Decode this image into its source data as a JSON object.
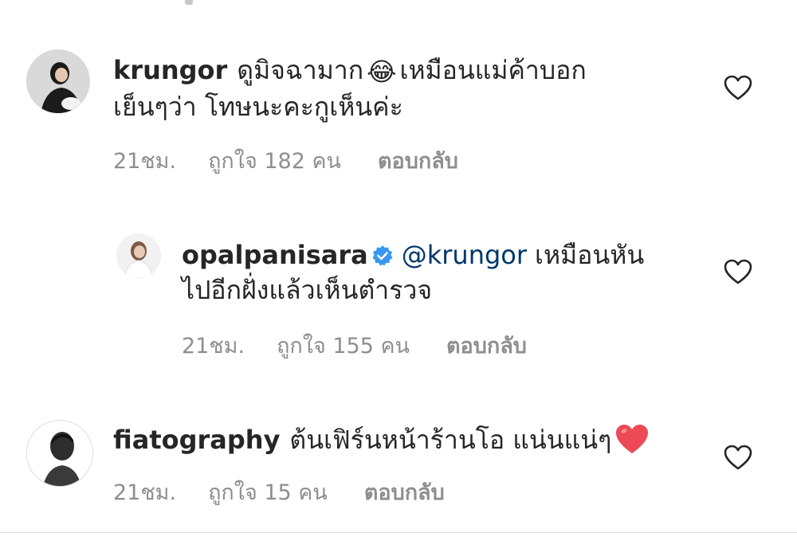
{
  "comments": [
    {
      "username": "krungor",
      "text_line1": "ดูมิจฉามาก",
      "emoji": "😂",
      "text_line1b": "เหมือนแม่ค้าบอก",
      "text_line2": "เย็นๆว่า โทษนะคะกูเห็นค่ะ",
      "time": "21ชม.",
      "likes": "ถูกใจ 182 คน",
      "reply_label": "ตอบกลับ",
      "avatar_icon": "avatar-photo-icon",
      "like_icon": "heart-outline-icon"
    },
    {
      "username": "opalpanisara",
      "verified": true,
      "mention": "@krungor",
      "text_line1": "เหมือนหัน",
      "text_line2": "ไปอีกฝั่งแล้วเห็นตำรวจ",
      "time": "21ชม.",
      "likes": "ถูกใจ 155 คน",
      "reply_label": "ตอบกลับ",
      "avatar_icon": "avatar-photo-icon",
      "like_icon": "heart-outline-icon"
    },
    {
      "username": "fiatography",
      "text_line1": "ต้นเฟิร์นหน้าร้านโอ แน่นแน่ๆ",
      "emoji": "❤️",
      "time": "21ชม.",
      "likes": "ถูกใจ 15 คน",
      "reply_label": "ตอบกลับ",
      "avatar_icon": "avatar-photo-icon",
      "like_icon": "heart-outline-icon"
    }
  ],
  "colors": {
    "text": "#262626",
    "muted": "#8e8e8e",
    "mention": "#00376b",
    "verified": "#3897f0",
    "heart_emoji": "#ed4956"
  }
}
